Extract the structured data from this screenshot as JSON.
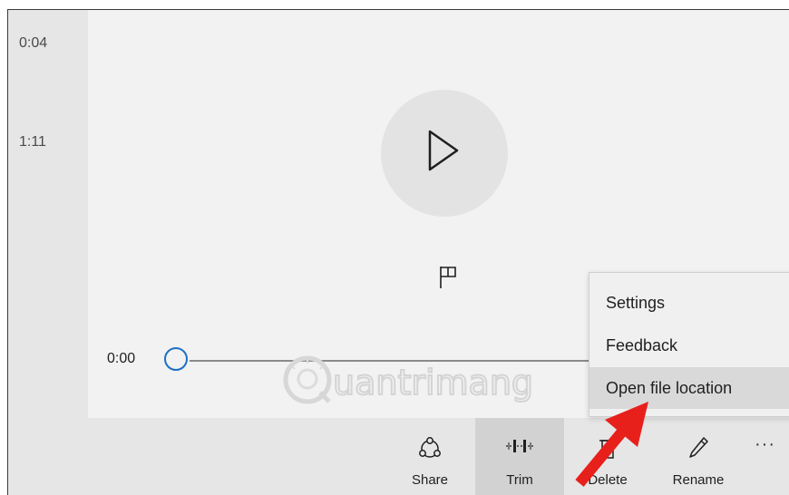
{
  "sidebar": {
    "items": [
      {
        "duration": "0:04"
      },
      {
        "duration": "1:11"
      }
    ]
  },
  "player": {
    "current_time": "0:00",
    "progress": 0.0,
    "play_icon": "play-icon",
    "marker_icon": "flag-icon"
  },
  "watermark": {
    "text": "uantrimang"
  },
  "menu": {
    "items": [
      {
        "label": "Settings"
      },
      {
        "label": "Feedback"
      },
      {
        "label": "Open file location",
        "highlighted": true
      }
    ]
  },
  "toolbar": {
    "share_label": "Share",
    "trim_label": "Trim",
    "delete_label": "Delete",
    "rename_label": "Rename",
    "more_label": "···"
  },
  "colors": {
    "accent": "#1e6fc5",
    "arrow": "#e8201c",
    "toolbar_bg": "#e6e6e6",
    "menu_highlight": "#d9d9d9"
  }
}
